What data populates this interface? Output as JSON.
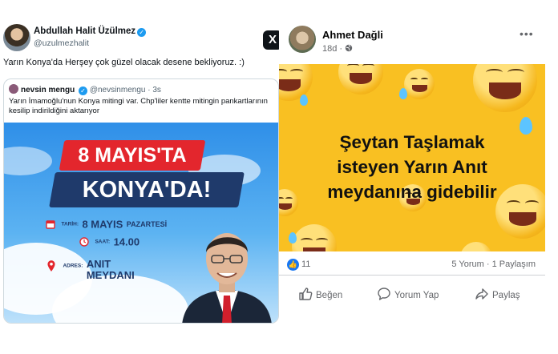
{
  "tweet": {
    "author_name": "Abdullah Halit Üzülmez",
    "handle": "@uzulmezhalit",
    "verified_mark": "✓",
    "x_logo": "X",
    "text": "Yarın Konya'da Herşey çok güzel olacak desene bekliyoruz.  :)",
    "quote": {
      "author_name": "nevsin mengu",
      "handle": "@nevsinmengu",
      "time": "· 3s",
      "text": "Yarın İmamoğlu'nun Konya mitingi var. Chp'liler kentte mitingin pankartlarının kesilip indirildiğini aktarıyor",
      "poster": {
        "headline_1": "8 MAYIS'TA",
        "headline_2": "KONYA'DA!",
        "date_label": "TARİH:",
        "date_value": "8 MAYIS",
        "date_day": "PAZARTESİ",
        "time_label": "SAAT:",
        "time_value": "14.00",
        "address_label": "ADRES:",
        "address_line_1": "ANIT",
        "address_line_2": "MEYDANI"
      }
    }
  },
  "facebook": {
    "author_name": "Ahmet Dağli",
    "time": "18d",
    "privacy_icon": "globe-icon",
    "more": "•••",
    "caption_line_1": "Şeytan Taşlamak",
    "caption_line_2": "isteyen Yarın Anıt",
    "caption_line_3": "meydanına gidebilir",
    "like_count": "11",
    "comments": "5 Yorum",
    "shares": "1 Paylaşım",
    "actions": {
      "like": "Beğen",
      "comment": "Yorum Yap",
      "share": "Paylaş"
    },
    "colors": {
      "like_blue": "#1877f2",
      "emoji_bg": "#f9c022"
    }
  }
}
